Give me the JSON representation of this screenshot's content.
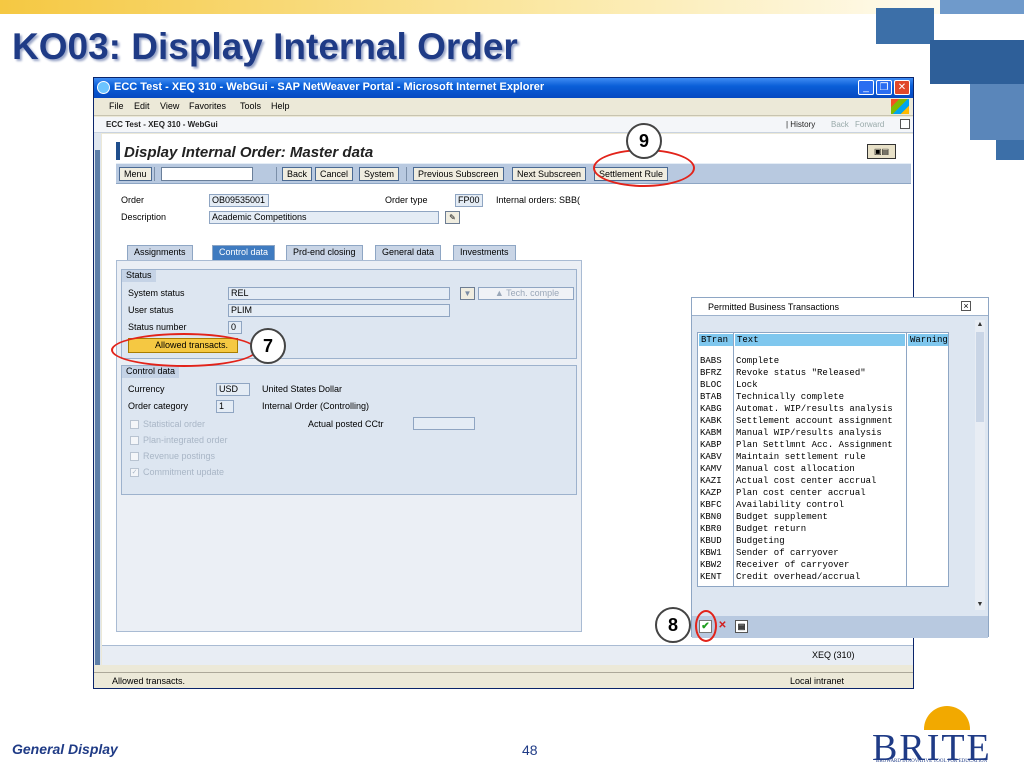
{
  "slide": {
    "title": "KO03: Display Internal Order",
    "footer_label": "General Display",
    "page_number": "48",
    "logo_text": "BRITE",
    "logo_subtext": "BROWARD INNOVATIVE TOOL FOR EDUCATION"
  },
  "browser": {
    "title": "ECC Test - XEQ 310 - WebGui - SAP NetWeaver Portal - Microsoft Internet Explorer",
    "menu": [
      "File",
      "Edit",
      "View",
      "Favorites",
      "Tools",
      "Help"
    ],
    "window_buttons": [
      "_",
      "❐",
      "✕"
    ],
    "status_text": "Allowed transacts.",
    "zone": "Local intranet"
  },
  "portal": {
    "title": "ECC Test - XEQ 310 - WebGui",
    "history": "| History",
    "back": "Back",
    "forward": "Forward"
  },
  "screen": {
    "title": "Display Internal Order: Master data",
    "toolbar": {
      "menu": "Menu",
      "back": "Back",
      "cancel": "Cancel",
      "system": "System",
      "previous_subscreen": "Previous Subscreen",
      "next_subscreen": "Next Subscreen",
      "settlement_rule": "Settlement Rule"
    },
    "header_fields": {
      "order_label": "Order",
      "order_value": "OB09535001",
      "order_type_label": "Order type",
      "order_type_value": "FP00",
      "order_type_text": "Internal orders: SBB(",
      "description_label": "Description",
      "description_value": "Academic Competitions"
    },
    "tabs": [
      "Assignments",
      "Control data",
      "Prd-end closing",
      "General data",
      "Investments"
    ],
    "active_tab": "Control data",
    "status_group": {
      "header": "Status",
      "system_status_label": "System status",
      "system_status_value": "REL",
      "tech_complete_label": "▲ Tech. comple",
      "user_status_label": "User status",
      "user_status_value": "PLIM",
      "status_number_label": "Status number",
      "status_number_value": "0",
      "allowed_transacts_label": "Allowed transacts."
    },
    "control_group": {
      "header": "Control data",
      "currency_label": "Currency",
      "currency_value": "USD",
      "currency_text": "United States Dollar",
      "order_category_label": "Order category",
      "order_category_value": "1",
      "order_category_text": "Internal Order (Controlling)",
      "actual_posted_label": "Actual posted CCtr",
      "checkboxes": [
        {
          "label": "Statistical order",
          "checked": false
        },
        {
          "label": "Plan-integrated order",
          "checked": false
        },
        {
          "label": "Revenue postings",
          "checked": false
        },
        {
          "label": "Commitment update",
          "checked": true
        }
      ]
    },
    "system_info": "XEQ (310)"
  },
  "popup": {
    "title": "Permitted Business Transactions",
    "columns": [
      "BTran",
      "Text",
      "Warning"
    ],
    "rows": [
      {
        "code": "BABS",
        "text": "Complete"
      },
      {
        "code": "BFRZ",
        "text": "Revoke status \"Released\""
      },
      {
        "code": "BLOC",
        "text": "Lock"
      },
      {
        "code": "BTAB",
        "text": "Technically complete"
      },
      {
        "code": "KABG",
        "text": "Automat. WIP/results analysis"
      },
      {
        "code": "KABK",
        "text": "Settlement account assignment"
      },
      {
        "code": "KABM",
        "text": "Manual WIP/results analysis"
      },
      {
        "code": "KABP",
        "text": "Plan Settlmnt Acc. Assignment"
      },
      {
        "code": "KABV",
        "text": "Maintain settlement rule"
      },
      {
        "code": "KAMV",
        "text": "Manual cost allocation"
      },
      {
        "code": "KAZI",
        "text": "Actual cost center accrual"
      },
      {
        "code": "KAZP",
        "text": "Plan cost center accrual"
      },
      {
        "code": "KBFC",
        "text": "Availability control"
      },
      {
        "code": "KBN0",
        "text": "Budget supplement"
      },
      {
        "code": "KBR0",
        "text": "Budget return"
      },
      {
        "code": "KBUD",
        "text": "Budgeting"
      },
      {
        "code": "KBW1",
        "text": "Sender of carryover"
      },
      {
        "code": "KBW2",
        "text": "Receiver of carryover"
      },
      {
        "code": "KENT",
        "text": "Credit overhead/accrual"
      }
    ]
  },
  "callouts": [
    "9",
    "7",
    "8"
  ],
  "colors": {
    "title_blue": "#1f3b86",
    "highlight_red": "#e2231a",
    "allowed_button": "#f5c842",
    "sap_toolbar": "#b8c9e0",
    "column_header": "#7fc7ee"
  }
}
